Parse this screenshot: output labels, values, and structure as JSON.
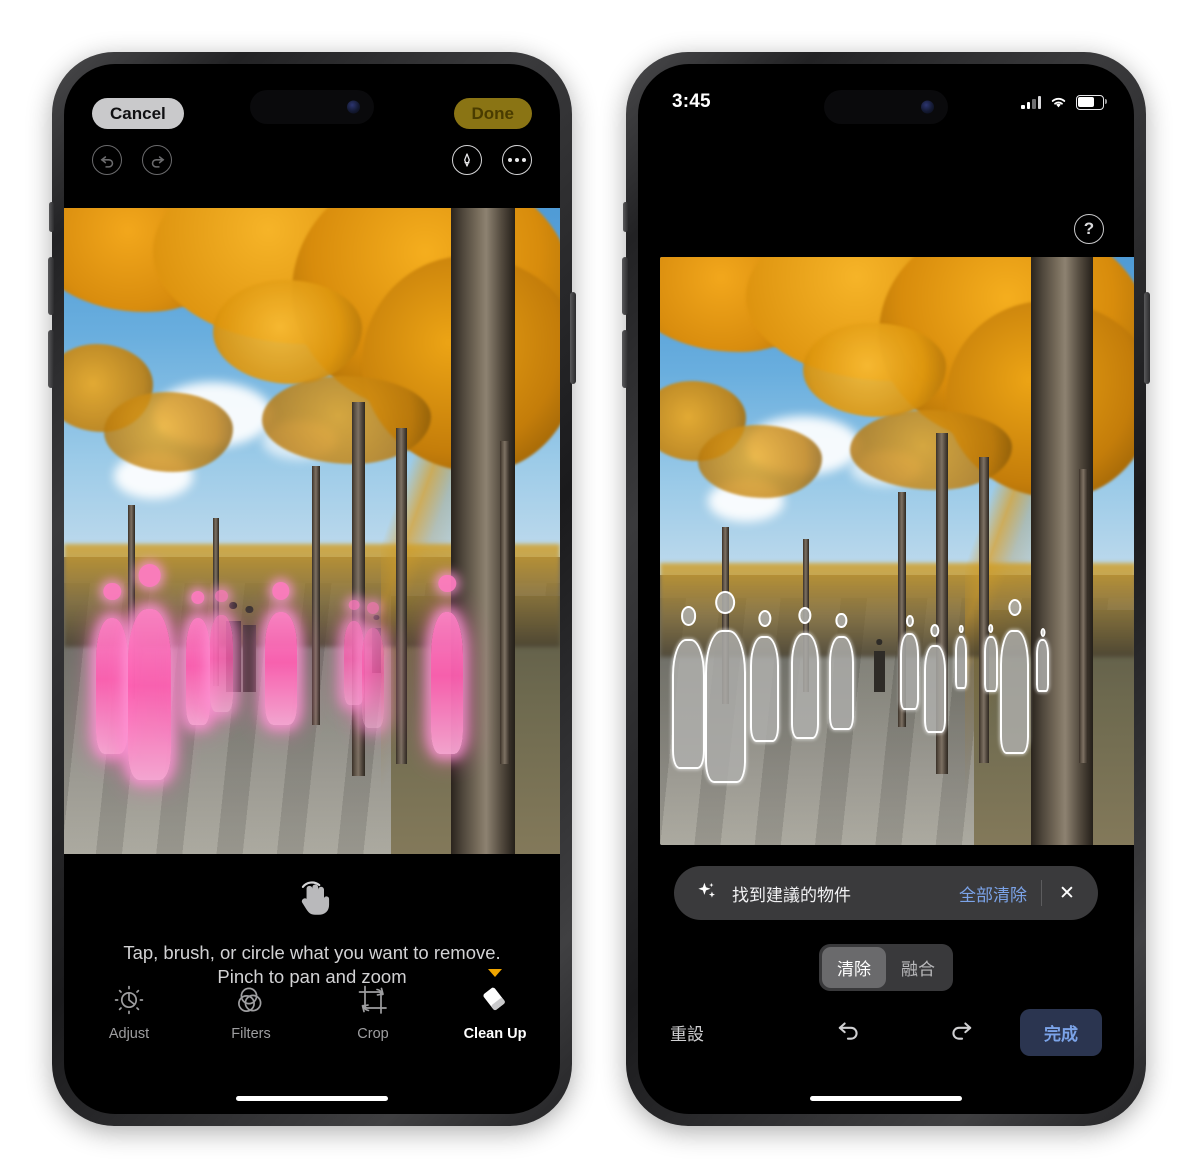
{
  "left_phone": {
    "header": {
      "cancel_label": "Cancel",
      "done_label": "Done",
      "undo_icon": "undo-icon",
      "redo_icon": "redo-icon",
      "markup_icon": "markup-pen-icon",
      "more_icon": "more-options-icon"
    },
    "hint": {
      "gesture_icon": "tap-hand-icon",
      "line1": "Tap, brush, or circle what you want to remove.",
      "line2": "Pinch to pan and zoom"
    },
    "tools": [
      {
        "label": "Adjust",
        "icon": "adjust-dial-icon",
        "active": false
      },
      {
        "label": "Filters",
        "icon": "filters-circles-icon",
        "active": false
      },
      {
        "label": "Crop",
        "icon": "crop-rotate-icon",
        "active": false
      },
      {
        "label": "Clean Up",
        "icon": "cleanup-eraser-icon",
        "active": true
      }
    ],
    "highlight_color": "#ff5fb2",
    "accent_color": "#f0a500"
  },
  "right_phone": {
    "status": {
      "time": "3:45",
      "cellular_icon": "cellular-signal-icon",
      "wifi_icon": "wifi-icon",
      "battery_icon": "battery-icon"
    },
    "help_label": "?",
    "banner": {
      "sparkle_icon": "sparkle-icon",
      "text": "找到建議的物件",
      "action_label": "全部清除",
      "close_icon": "close-icon"
    },
    "segmented": {
      "options": [
        "清除",
        "融合"
      ],
      "selected": "清除"
    },
    "bottom_bar": {
      "reset_label": "重設",
      "undo_icon": "undo-icon",
      "redo_icon": "redo-icon",
      "done_label": "完成"
    },
    "accent_color": "#7ba3e8",
    "selection_outline_color": "#ffffff"
  },
  "photo": {
    "description": "ginkgo-tree-avenue-with-pedestrians"
  }
}
